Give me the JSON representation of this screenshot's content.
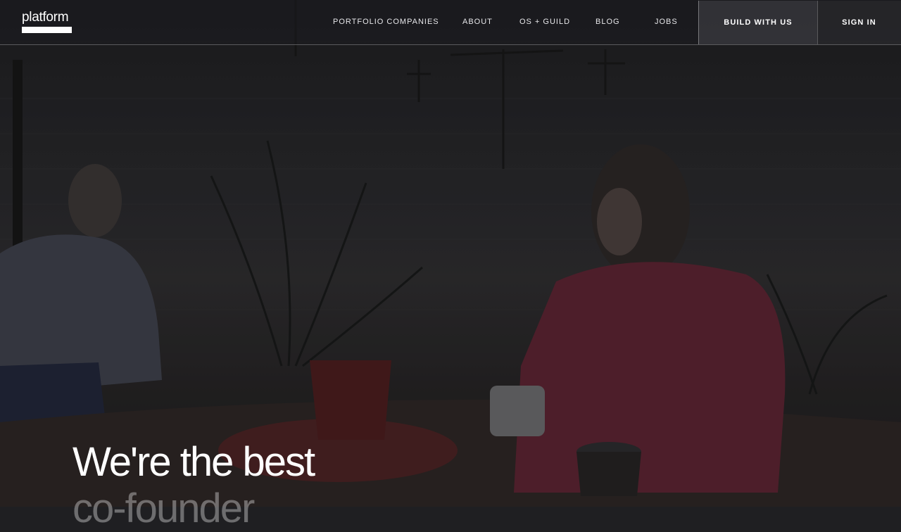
{
  "brand": {
    "logo_text": "platform"
  },
  "nav": {
    "links": [
      "PORTFOLIO COMPANIES",
      "ABOUT",
      "OS + GUILD",
      "BLOG",
      "JOBS"
    ],
    "build_label": "BUILD WITH US",
    "signin_label": "SIGN IN"
  },
  "hero": {
    "line1": "We're the best",
    "line2": "co-founder"
  },
  "colors": {
    "background": "#1f1f22",
    "text": "#ffffff",
    "header_border": "#6b6b70"
  }
}
